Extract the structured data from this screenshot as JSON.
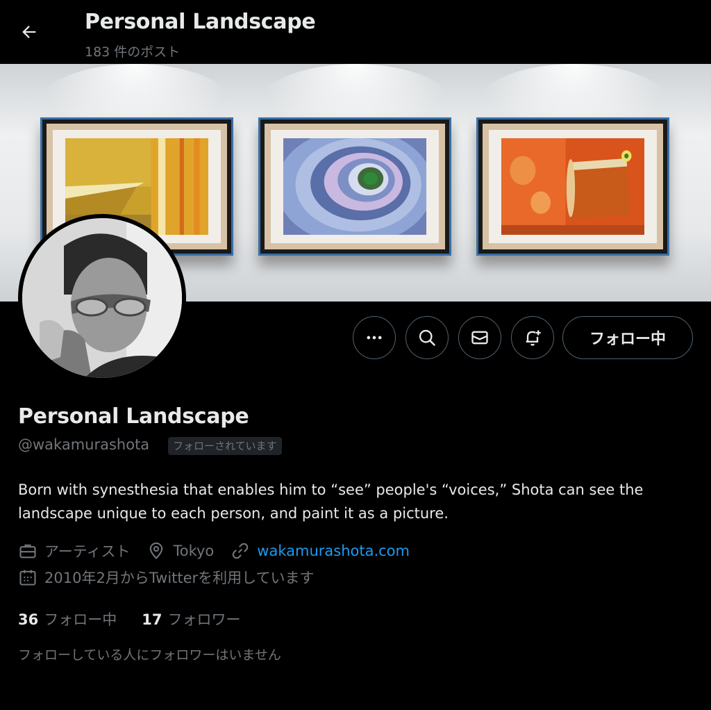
{
  "header": {
    "title": "Personal Landscape",
    "post_count": "183 件のポスト"
  },
  "actions": {
    "follow_label": "フォロー中"
  },
  "profile": {
    "display_name": "Personal Landscape",
    "handle": "@wakamurashota",
    "follows_you_badge": "フォローされています",
    "bio": "Born with synesthesia that enables him to “see” people's “voices,” Shota can see the landscape unique to each person, and paint it as a picture.",
    "profession": "アーティスト",
    "location": "Tokyo",
    "website": "wakamurashota.com",
    "joined": "2010年2月からTwitterを利用しています"
  },
  "stats": {
    "following_count": "36",
    "following_label": "フォロー中",
    "followers_count": "17",
    "followers_label": "フォロワー"
  },
  "mutual_note": "フォローしている人にフォロワーはいません",
  "colors": {
    "background": "#000000",
    "primary_text": "#e7e9ea",
    "secondary_text": "#71767b",
    "link": "#1d9bf0",
    "button_border": "#536471"
  }
}
